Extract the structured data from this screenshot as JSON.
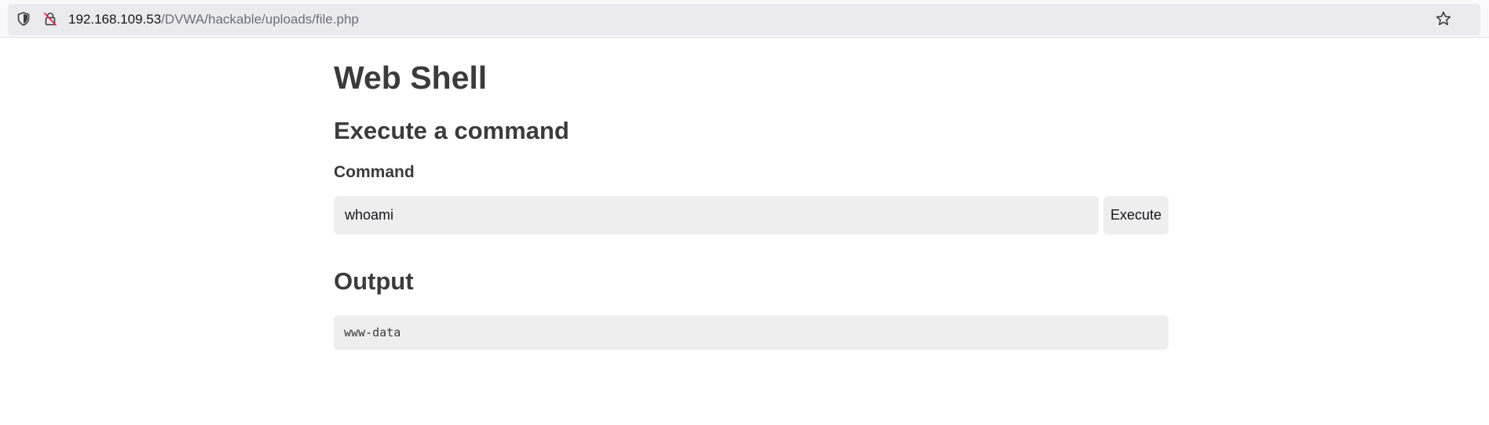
{
  "browser": {
    "url_host": "192.168.109.53",
    "url_path": "/DVWA/hackable/uploads/file.php",
    "icons": [
      "shield-icon",
      "insecure-lock-icon",
      "star-icon"
    ]
  },
  "page": {
    "title": "Web Shell",
    "execute_heading": "Execute a command",
    "command_label": "Command",
    "command_value": "whoami",
    "execute_button": "Execute",
    "output_heading": "Output",
    "output_text": "www-data"
  },
  "colors": {
    "text": "#3b3b3b",
    "field_background": "#eeeeee",
    "insecure_accent": "#e22850"
  }
}
